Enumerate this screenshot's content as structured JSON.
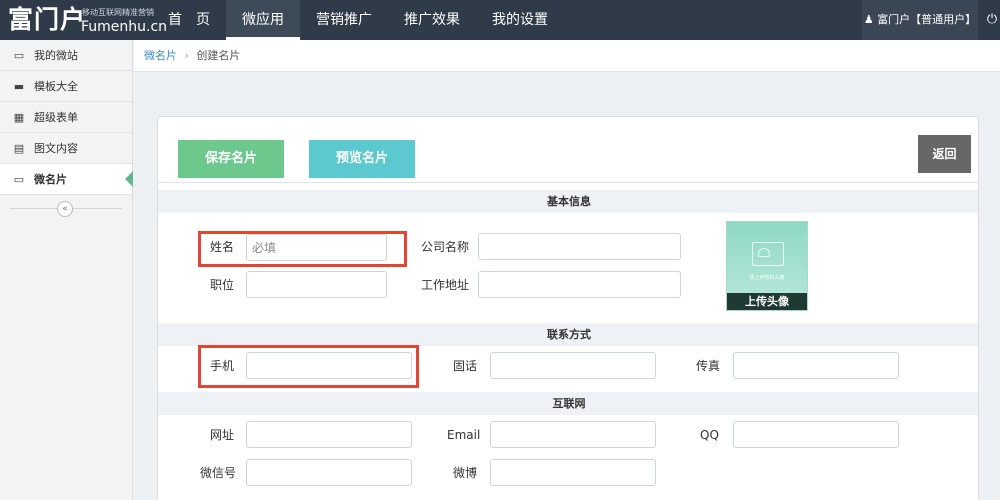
{
  "brand": {
    "logo_text": "富门户",
    "tagline": "移动互联网精准营销",
    "domain": "Fumenhu.cn"
  },
  "nav": {
    "items": [
      {
        "label": "首　页",
        "active": false
      },
      {
        "label": "微应用",
        "active": true
      },
      {
        "label": "营销推广",
        "active": false
      },
      {
        "label": "推广效果",
        "active": false
      },
      {
        "label": "我的设置",
        "active": false
      }
    ]
  },
  "user": {
    "icon": "user-icon",
    "label": "富门户【普通用户】",
    "power_icon": "power-icon"
  },
  "sidebar": {
    "items": [
      {
        "icon": "monitor-icon",
        "glyph": "▭",
        "label": "我的微站"
      },
      {
        "icon": "folder-icon",
        "glyph": "▬",
        "label": "模板大全"
      },
      {
        "icon": "calendar-icon",
        "glyph": "▦",
        "label": "超级表单"
      },
      {
        "icon": "book-icon",
        "glyph": "▤",
        "label": "图文内容"
      },
      {
        "icon": "card-icon",
        "glyph": "▭",
        "label": "微名片",
        "active": true
      }
    ],
    "collapse_glyph": "«"
  },
  "breadcrumb": {
    "parent": "微名片",
    "separator": "›",
    "current": "创建名片"
  },
  "toolbar": {
    "save_label": "保存名片",
    "preview_label": "预览名片",
    "back_label": "返回"
  },
  "sections": {
    "basic": "基本信息",
    "contact": "联系方式",
    "internet": "互联网"
  },
  "fields": {
    "name_label": "姓名",
    "name_placeholder": "必填",
    "company_label": "公司名称",
    "position_label": "职位",
    "address_label": "工作地址",
    "mobile_label": "手机",
    "phone_label": "固话",
    "fax_label": "传真",
    "website_label": "网址",
    "email_label": "Email",
    "qq_label": "QQ",
    "wechat_label": "微信号",
    "weibo_label": "微博"
  },
  "avatar": {
    "hint": "请上传您的头像",
    "upload_label": "上传头像"
  },
  "colors": {
    "topbar": "#2f3b48",
    "save": "#6dc88e",
    "preview": "#5cc8cf",
    "back": "#666666",
    "highlight": "#e34532",
    "breadcrumb_link": "#3a8ccf"
  }
}
